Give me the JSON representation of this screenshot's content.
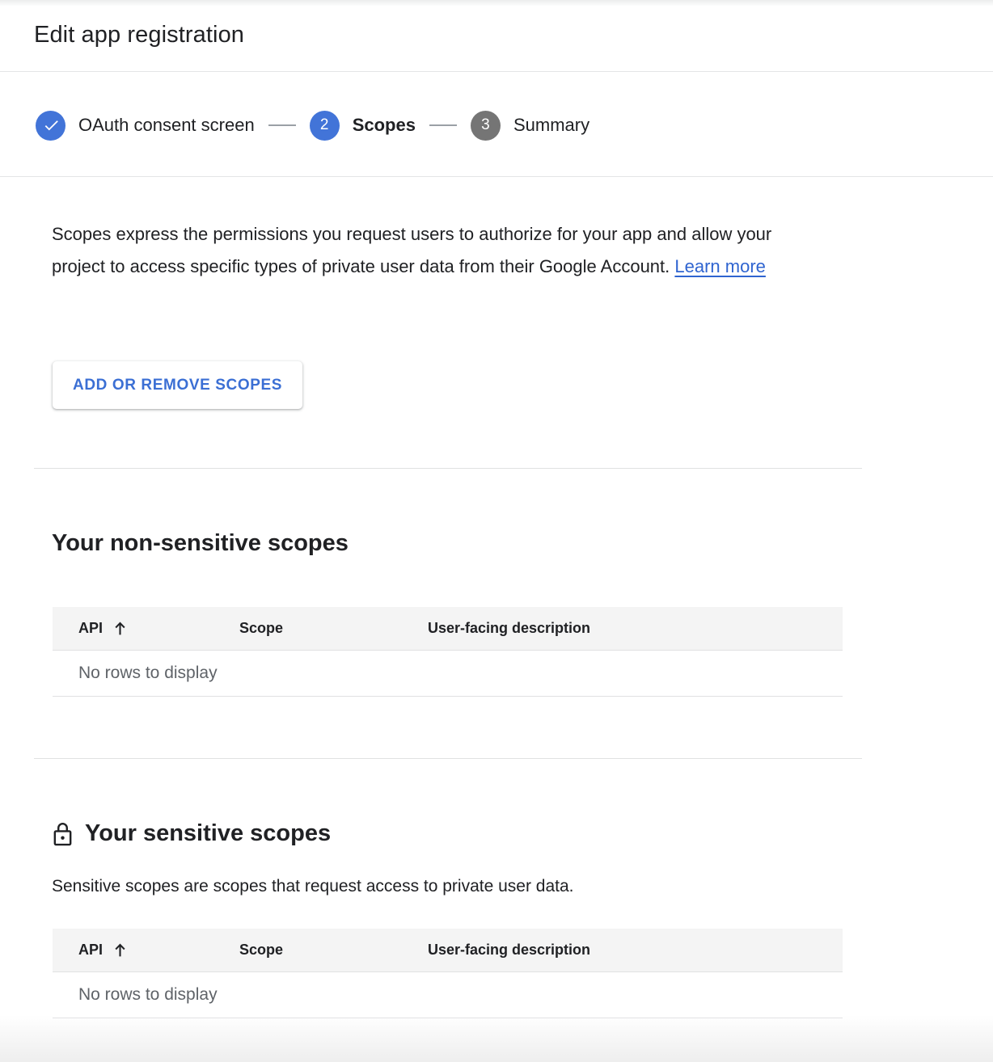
{
  "header": {
    "title": "Edit app registration"
  },
  "stepper": {
    "steps": [
      {
        "badge": "check-icon",
        "number": "",
        "label": "OAuth consent screen",
        "state": "done"
      },
      {
        "badge": "number",
        "number": "2",
        "label": "Scopes",
        "state": "active"
      },
      {
        "badge": "number",
        "number": "3",
        "label": "Summary",
        "state": "upcoming"
      }
    ]
  },
  "intro": {
    "text": "Scopes express the permissions you request users to authorize for your app and allow your project to access specific types of private user data from their Google Account.",
    "link_label": "Learn more"
  },
  "actions": {
    "add_remove_scopes_label": "ADD OR REMOVE SCOPES"
  },
  "sections": [
    {
      "id": "non-sensitive",
      "title": "Your non-sensitive scopes",
      "icon": "",
      "subtitle": "",
      "table": {
        "columns": [
          "API",
          "Scope",
          "User-facing description"
        ],
        "sort_column": "API",
        "sort_direction": "ascending",
        "rows": [],
        "empty_message": "No rows to display"
      }
    },
    {
      "id": "sensitive",
      "title": "Your sensitive scopes",
      "icon": "lock-icon",
      "subtitle": "Sensitive scopes are scopes that request access to private user data.",
      "table": {
        "columns": [
          "API",
          "Scope",
          "User-facing description"
        ],
        "sort_column": "API",
        "sort_direction": "ascending",
        "rows": [],
        "empty_message": "No rows to display"
      }
    }
  ],
  "colors": {
    "accent_blue": "#4274d8",
    "link_blue": "#2f64d0",
    "button_text": "#3b6fd4",
    "upcoming_gray": "#757575",
    "table_header_bg": "#f4f4f4",
    "divider": "#e0e1e2",
    "muted_text": "#5f6368"
  }
}
